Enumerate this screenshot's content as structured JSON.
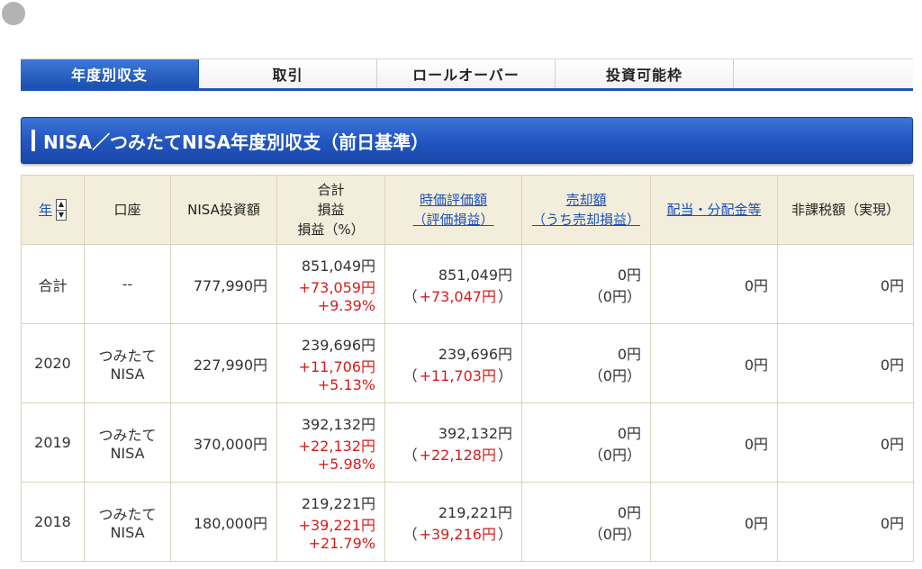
{
  "tabs": [
    "年度別収支",
    "取引",
    "ロールオーバー",
    "投資可能枠"
  ],
  "section_title": "NISA／つみたてNISA年度別収支（前日基準）",
  "headers": {
    "year": "年",
    "account": "口座",
    "investment": "NISA投資額",
    "total_l1": "合計",
    "total_l2": "損益",
    "total_l3": "損益（%）",
    "market_l1": "時価評価額",
    "market_l2": "（評価損益）",
    "sale_l1": "売却額",
    "sale_l2": "（うち売却損益）",
    "dividend": "配当・分配金等",
    "taxfree": "非課税額（実現）"
  },
  "rows": [
    {
      "year": "合計",
      "account_l1": "--",
      "account_l2": "",
      "investment": "777,990円",
      "total": "851,049円",
      "total_pl": "+73,059円",
      "total_pct": "+9.39%",
      "market": "851,049円",
      "market_pl": "+73,047円",
      "sale": "0円",
      "sale_pl": "0円",
      "dividend": "0円",
      "taxfree": "0円"
    },
    {
      "year": "2020",
      "account_l1": "つみたて",
      "account_l2": "NISA",
      "investment": "227,990円",
      "total": "239,696円",
      "total_pl": "+11,706円",
      "total_pct": "+5.13%",
      "market": "239,696円",
      "market_pl": "+11,703円",
      "sale": "0円",
      "sale_pl": "0円",
      "dividend": "0円",
      "taxfree": "0円"
    },
    {
      "year": "2019",
      "account_l1": "つみたて",
      "account_l2": "NISA",
      "investment": "370,000円",
      "total": "392,132円",
      "total_pl": "+22,132円",
      "total_pct": "+5.98%",
      "market": "392,132円",
      "market_pl": "+22,128円",
      "sale": "0円",
      "sale_pl": "0円",
      "dividend": "0円",
      "taxfree": "0円"
    },
    {
      "year": "2018",
      "account_l1": "つみたて",
      "account_l2": "NISA",
      "investment": "180,000円",
      "total": "219,221円",
      "total_pl": "+39,221円",
      "total_pct": "+21.79%",
      "market": "219,221円",
      "market_pl": "+39,216円",
      "sale": "0円",
      "sale_pl": "0円",
      "dividend": "0円",
      "taxfree": "0円"
    }
  ]
}
